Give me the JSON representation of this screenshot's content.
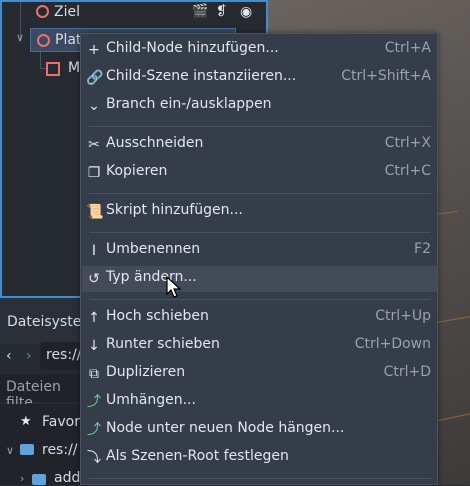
{
  "scene_tree": {
    "nodes": [
      {
        "label": "Ziel"
      },
      {
        "label": "Platt"
      },
      {
        "label": "M"
      }
    ]
  },
  "filesystem": {
    "tab_label": "Dateisyster",
    "path_value": "res://",
    "filter_placeholder": "Dateien filte",
    "items": [
      {
        "label": "Favor"
      },
      {
        "label": "res://"
      },
      {
        "label": "add"
      }
    ]
  },
  "context_menu": {
    "items": [
      {
        "icon": "plus-icon",
        "label": "Child-Node hinzufügen...",
        "shortcut": "Ctrl+A"
      },
      {
        "icon": "link-icon",
        "label": "Child-Szene instanziieren...",
        "shortcut": "Ctrl+Shift+A"
      },
      {
        "icon": "branch-toggle-icon",
        "label": "Branch ein-/ausklappen",
        "shortcut": ""
      },
      {
        "icon": "scissors-icon",
        "label": "Ausschneiden",
        "shortcut": "Ctrl+X"
      },
      {
        "icon": "copy-icon",
        "label": "Kopieren",
        "shortcut": "Ctrl+C"
      },
      {
        "icon": "script-add-icon",
        "label": "Skript hinzufügen...",
        "shortcut": ""
      },
      {
        "icon": "rename-icon",
        "label": "Umbenennen",
        "shortcut": "F2"
      },
      {
        "icon": "change-type-icon",
        "label": "Typ ändern...",
        "shortcut": ""
      },
      {
        "icon": "arrow-up-icon",
        "label": "Hoch schieben",
        "shortcut": "Ctrl+Up"
      },
      {
        "icon": "arrow-down-icon",
        "label": "Runter schieben",
        "shortcut": "Ctrl+Down"
      },
      {
        "icon": "duplicate-icon",
        "label": "Duplizieren",
        "shortcut": "Ctrl+D"
      },
      {
        "icon": "reparent-icon",
        "label": "Umhängen...",
        "shortcut": ""
      },
      {
        "icon": "reparent-new-node-icon",
        "label": "Node unter neuen Node hängen...",
        "shortcut": ""
      },
      {
        "icon": "make-root-icon",
        "label": "Als Szenen-Root festlegen",
        "shortcut": ""
      }
    ]
  },
  "colors": {
    "accent": "#3e8fd6",
    "node_red": "#ef6f6f",
    "menu_bg": "#363d4a",
    "hover_bg": "#434b58"
  }
}
